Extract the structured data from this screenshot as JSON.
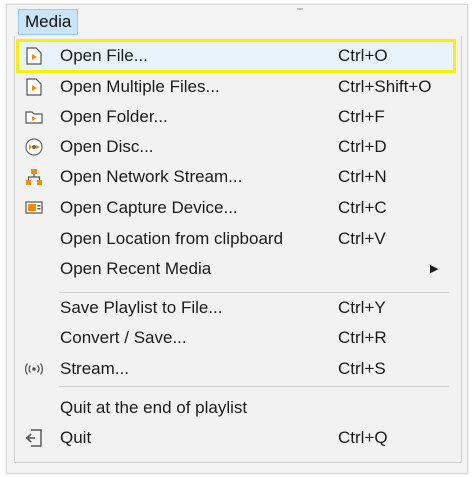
{
  "menu_title": "Media",
  "items": [
    {
      "label": "Open File...",
      "shortcut": "Ctrl+O",
      "icon": "open-file-icon"
    },
    {
      "label": "Open Multiple Files...",
      "shortcut": "Ctrl+Shift+O",
      "icon": "open-multiple-files-icon"
    },
    {
      "label": "Open Folder...",
      "shortcut": "Ctrl+F",
      "icon": "folder-icon"
    },
    {
      "label": "Open Disc...",
      "shortcut": "Ctrl+D",
      "icon": "disc-icon"
    },
    {
      "label": "Open Network Stream...",
      "shortcut": "Ctrl+N",
      "icon": "network-icon"
    },
    {
      "label": "Open Capture Device...",
      "shortcut": "Ctrl+C",
      "icon": "capture-device-icon"
    },
    {
      "label": "Open Location from clipboard",
      "shortcut": "Ctrl+V",
      "icon": ""
    },
    {
      "label": "Open Recent Media",
      "shortcut": "",
      "icon": "",
      "submenu": true
    },
    {
      "label": "Save Playlist to File...",
      "shortcut": "Ctrl+Y",
      "icon": ""
    },
    {
      "label": "Convert / Save...",
      "shortcut": "Ctrl+R",
      "icon": ""
    },
    {
      "label": "Stream...",
      "shortcut": "Ctrl+S",
      "icon": "stream-icon"
    },
    {
      "label": "Quit at the end of playlist",
      "shortcut": "",
      "icon": ""
    },
    {
      "label": "Quit",
      "shortcut": "Ctrl+Q",
      "icon": "quit-icon"
    }
  ],
  "highlight_color": "#f7f300",
  "menubar_tab_color": "#cce4f7"
}
